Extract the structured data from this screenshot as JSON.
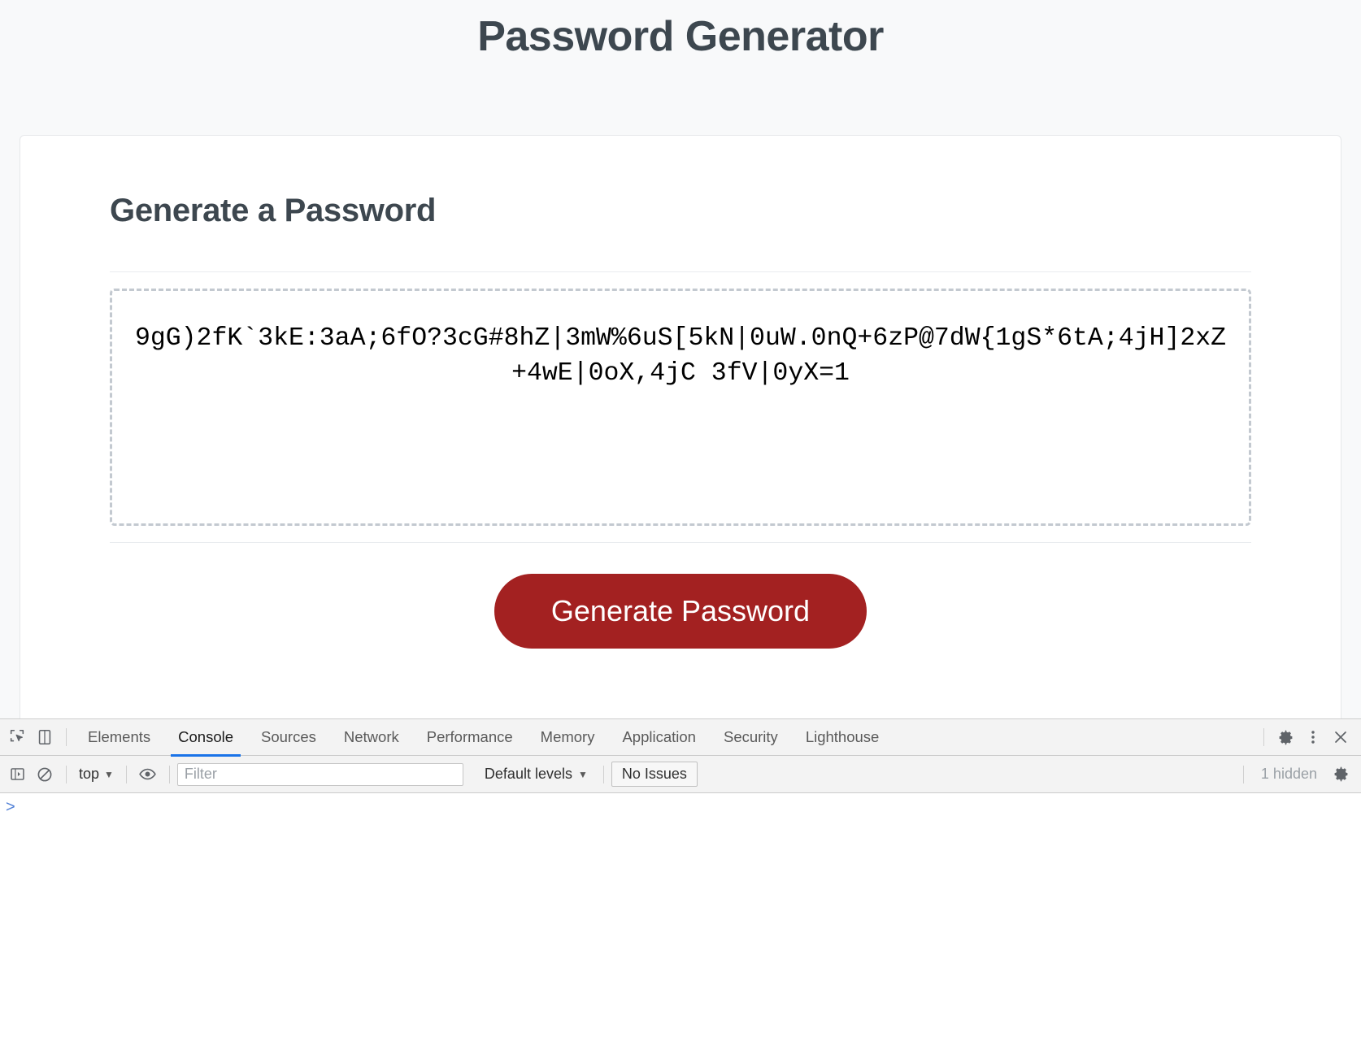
{
  "page": {
    "title": "Password Generator",
    "card": {
      "heading": "Generate a Password",
      "password": "9gG)2fK`3kE:3aA;6fO?3cG#8hZ|3mW%6uS[5kN|0uW.0nQ+6zP@7dW{1gS*6tA;4jH]2xZ+4wE|0oX,4jC 3fV|0yX=1",
      "generate_button": "Generate Password"
    },
    "colors": {
      "background": "#f8f9fa",
      "heading_text": "#3d474f",
      "button_background": "#a32121",
      "button_text": "#ffffff",
      "password_border": "#c3c9d0"
    }
  },
  "devtools": {
    "tabs": [
      {
        "label": "Elements",
        "active": false
      },
      {
        "label": "Console",
        "active": true
      },
      {
        "label": "Sources",
        "active": false
      },
      {
        "label": "Network",
        "active": false
      },
      {
        "label": "Performance",
        "active": false
      },
      {
        "label": "Memory",
        "active": false
      },
      {
        "label": "Application",
        "active": false
      },
      {
        "label": "Security",
        "active": false
      },
      {
        "label": "Lighthouse",
        "active": false
      }
    ],
    "icons": {
      "inspect": "inspect-element-icon",
      "device": "device-toolbar-icon",
      "settings": "gear-icon",
      "more": "more-options-icon",
      "close": "close-icon",
      "execute": "execute-sidebar-icon",
      "clear": "clear-console-icon",
      "eye": "live-expression-icon",
      "issues_gear": "issues-settings-icon"
    },
    "toolbar": {
      "context": "top",
      "filter_placeholder": "Filter",
      "filter_value": "",
      "levels": "Default levels",
      "issues": "No Issues",
      "hidden": "1 hidden"
    },
    "console": {
      "prompt": ">",
      "active_tab_accent": "#1a73e8"
    }
  }
}
